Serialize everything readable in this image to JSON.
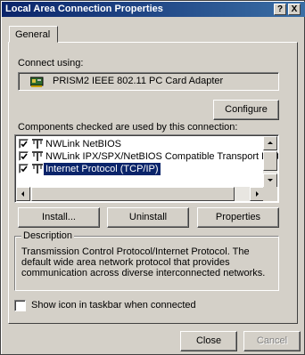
{
  "window": {
    "title": "Local Area Connection Properties",
    "help_label": "?",
    "close_label": "X"
  },
  "tabs": [
    {
      "label": "General"
    }
  ],
  "connect_using": {
    "label": "Connect using:",
    "adapter": "PRISM2 IEEE 802.11 PC Card Adapter",
    "configure_label": "Configure"
  },
  "components": {
    "label": "Components checked are used by this connection:",
    "items": [
      {
        "label": "NWLink NetBIOS",
        "checked": true,
        "selected": false
      },
      {
        "label": "NWLink IPX/SPX/NetBIOS Compatible Transport Proto",
        "checked": true,
        "selected": false
      },
      {
        "label": "Internet Protocol (TCP/IP)",
        "checked": true,
        "selected": true
      }
    ]
  },
  "buttons": {
    "install": "Install...",
    "uninstall": "Uninstall",
    "properties": "Properties",
    "close": "Close",
    "cancel": "Cancel"
  },
  "description": {
    "legend": "Description",
    "text": "Transmission Control Protocol/Internet Protocol. The default wide area network protocol that provides communication across diverse interconnected networks."
  },
  "show_icon": {
    "label": "Show icon in taskbar when connected",
    "checked": false
  },
  "colors": {
    "face": "#d4d0c8",
    "title_start": "#0a246a",
    "title_end": "#3a6ea5",
    "selection": "#0a246a"
  },
  "icons": {
    "adapter": "network-card-icon",
    "component": "network-component-icon"
  }
}
